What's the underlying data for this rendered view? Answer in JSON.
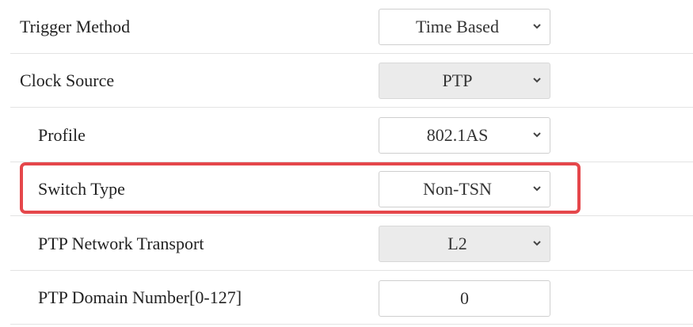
{
  "settings": {
    "rows": [
      {
        "label": "Trigger Method",
        "value": "Time Based",
        "disabled": false
      },
      {
        "label": "Clock Source",
        "value": "PTP",
        "disabled": true
      },
      {
        "label": "Profile",
        "value": "802.1AS",
        "disabled": false
      },
      {
        "label": "Switch Type",
        "value": "Non-TSN",
        "disabled": false,
        "highlighted": true
      },
      {
        "label": "PTP Network Transport",
        "value": "L2",
        "disabled": true
      },
      {
        "label": "PTP Domain Number[0-127]",
        "value": "0"
      }
    ]
  },
  "colors": {
    "highlight_border": "#e5474b",
    "disabled_background": "#ebebeb",
    "row_divider": "#e3e3e3"
  },
  "icons": {
    "dropdown": "chevron-down-icon"
  }
}
